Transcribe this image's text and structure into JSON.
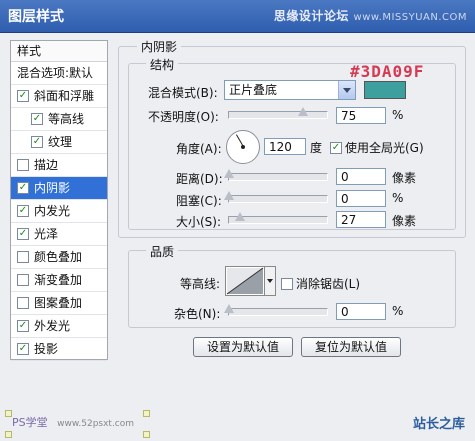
{
  "window": {
    "title": "图层样式",
    "site_name": "思缘设计论坛",
    "site_domain": "www.MISSYUAN.COM"
  },
  "sidebar": {
    "header": "样式",
    "items": [
      {
        "label": "混合选项:默认",
        "checkbox": false,
        "checked": false,
        "sub": false,
        "selected": false
      },
      {
        "label": "斜面和浮雕",
        "checkbox": true,
        "checked": true,
        "sub": false,
        "selected": false
      },
      {
        "label": "等高线",
        "checkbox": true,
        "checked": true,
        "sub": true,
        "selected": false
      },
      {
        "label": "纹理",
        "checkbox": true,
        "checked": true,
        "sub": true,
        "selected": false
      },
      {
        "label": "描边",
        "checkbox": true,
        "checked": false,
        "sub": false,
        "selected": false
      },
      {
        "label": "内阴影",
        "checkbox": true,
        "checked": true,
        "sub": false,
        "selected": true
      },
      {
        "label": "内发光",
        "checkbox": true,
        "checked": true,
        "sub": false,
        "selected": false
      },
      {
        "label": "光泽",
        "checkbox": true,
        "checked": true,
        "sub": false,
        "selected": false
      },
      {
        "label": "颜色叠加",
        "checkbox": true,
        "checked": false,
        "sub": false,
        "selected": false
      },
      {
        "label": "渐变叠加",
        "checkbox": true,
        "checked": false,
        "sub": false,
        "selected": false
      },
      {
        "label": "图案叠加",
        "checkbox": true,
        "checked": false,
        "sub": false,
        "selected": false
      },
      {
        "label": "外发光",
        "checkbox": true,
        "checked": true,
        "sub": false,
        "selected": false
      },
      {
        "label": "投影",
        "checkbox": true,
        "checked": true,
        "sub": false,
        "selected": false
      }
    ]
  },
  "panel": {
    "title": "内阴影",
    "structure": {
      "title": "结构",
      "hex_annotation": "#3DA09F",
      "blend_label": "混合模式(B):",
      "blend_value": "正片叠底",
      "color": "#3DA09F",
      "opacity_label": "不透明度(O):",
      "opacity_value": "75",
      "opacity_level": 0.75,
      "percent": "%",
      "angle_label": "角度(A):",
      "angle_value": "120",
      "angle_unit": "度",
      "global_light_label": "使用全局光(G)",
      "global_light_checked": true,
      "distance_label": "距离(D):",
      "distance_value": "0",
      "choke_label": "阻塞(C):",
      "choke_value": "0",
      "size_label": "大小(S):",
      "size_value": "27",
      "size_level": 0.108,
      "px_unit": "像素"
    },
    "quality": {
      "title": "品质",
      "contour_label": "等高线:",
      "antialias_label": "消除锯齿(L)",
      "antialias_checked": false,
      "noise_label": "杂色(N):",
      "noise_value": "0",
      "percent": "%"
    },
    "buttons": {
      "set_default": "设置为默认值",
      "reset_default": "复位为默认值"
    }
  },
  "watermarks": {
    "left_brand": "PS学堂",
    "left_url": "www.52psxt.com",
    "right_brand": "站长之库"
  }
}
